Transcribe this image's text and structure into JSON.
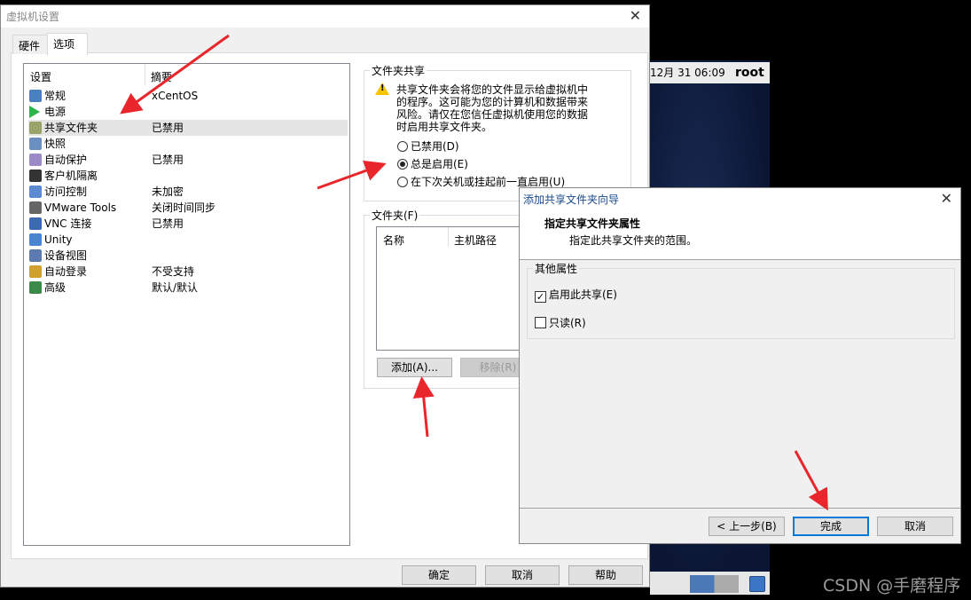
{
  "main_dialog": {
    "title": "虚拟机设置",
    "tabs": [
      {
        "label": "硬件",
        "selected": false
      },
      {
        "label": "选项",
        "selected": true
      }
    ],
    "list": {
      "headers": [
        "设置",
        "摘要"
      ],
      "items": [
        {
          "name": "常规",
          "summary": "xCentOS",
          "icon": "monitor-icon"
        },
        {
          "name": "电源",
          "summary": "",
          "icon": "play-icon"
        },
        {
          "name": "共享文件夹",
          "summary": "已禁用",
          "icon": "folder-icon",
          "selected": true
        },
        {
          "name": "快照",
          "summary": "",
          "icon": "snapshot-clock-icon"
        },
        {
          "name": "自动保护",
          "summary": "已禁用",
          "icon": "autoprotect-icon"
        },
        {
          "name": "客户机隔离",
          "summary": "",
          "icon": "lock-icon"
        },
        {
          "name": "访问控制",
          "summary": "未加密",
          "icon": "access-control-icon"
        },
        {
          "name": "VMware Tools",
          "summary": "关闭时间同步",
          "icon": "vm-icon"
        },
        {
          "name": "VNC 连接",
          "summary": "已禁用",
          "icon": "vnc-monitor-icon"
        },
        {
          "name": "Unity",
          "summary": "",
          "icon": "unity-icon"
        },
        {
          "name": "设备视图",
          "summary": "",
          "icon": "device-view-icon"
        },
        {
          "name": "自动登录",
          "summary": "不受支持",
          "icon": "user-key-icon"
        },
        {
          "name": "高级",
          "summary": "默认/默认",
          "icon": "advanced-chart-icon"
        }
      ]
    },
    "sharing": {
      "group_label": "文件夹共享",
      "warning_lines": [
        "共享文件夹会将您的文件显示给虚拟机中",
        "的程序。这可能为您的计算机和数据带来",
        "风险。请仅在您信任虚拟机使用您的数据",
        "时启用共享文件夹。"
      ],
      "options": [
        {
          "label": "已禁用(D)",
          "checked": false
        },
        {
          "label": "总是启用(E)",
          "checked": true
        },
        {
          "label": "在下次关机或挂起前一直启用(U)",
          "checked": false
        }
      ]
    },
    "folders": {
      "group_label": "文件夹(F)",
      "headers": [
        "名称",
        "主机路径"
      ],
      "add_label": "添加(A)...",
      "remove_label": "移除(R)"
    },
    "buttons": {
      "ok": "确定",
      "cancel": "取消",
      "help": "帮助"
    }
  },
  "vm_screen": {
    "clock": "12月 31 06:09",
    "user": "root"
  },
  "wizard": {
    "title": "添加共享文件夹向导",
    "heading": "指定共享文件夹属性",
    "subheading": "指定此共享文件夹的范围。",
    "group_label": "其他属性",
    "options": [
      {
        "label": "启用此共享(E)",
        "checked": true
      },
      {
        "label": "只读(R)",
        "checked": false
      }
    ],
    "buttons": {
      "back": "< 上一步(B)",
      "finish": "完成",
      "cancel": "取消"
    }
  },
  "watermark": "CSDN @手磨程序",
  "colors": {
    "annotation_arrow": "#e8262b",
    "focus_border": "#0078d7",
    "vm_bg": "#0d1a3a"
  }
}
